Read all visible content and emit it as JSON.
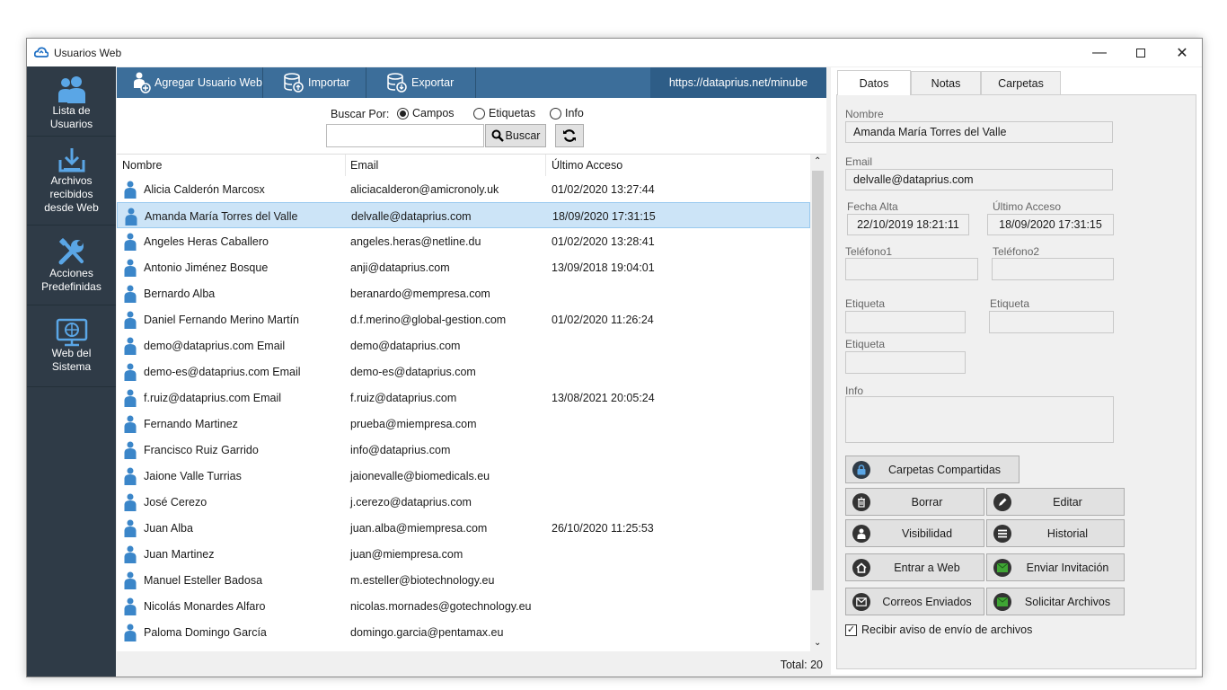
{
  "window": {
    "title": "Usuarios Web"
  },
  "sidebar": {
    "items": [
      {
        "label": "Lista de Usuarios",
        "lines": [
          "Lista de",
          "Usuarios"
        ],
        "icon": "users-icon"
      },
      {
        "label": "Archivos recibidos desde Web",
        "lines": [
          "Archivos",
          "recibidos",
          "desde Web"
        ],
        "icon": "download-icon"
      },
      {
        "label": "Acciones Predefinidas",
        "lines": [
          "Acciones",
          "Predefinidas"
        ],
        "icon": "tools-icon"
      },
      {
        "label": "Web del Sistema",
        "lines": [
          "Web del",
          "Sistema"
        ],
        "icon": "monitor-globe-icon"
      }
    ]
  },
  "toolbar": {
    "add_label": "Agregar Usuario Web",
    "import_label": "Importar",
    "export_label": "Exportar",
    "url": "https://dataprius.net/minube"
  },
  "search": {
    "by_label": "Buscar Por:",
    "options": [
      "Campos",
      "Etiquetas",
      "Info"
    ],
    "selected": "Campos",
    "value": "",
    "button_label": "Buscar"
  },
  "table": {
    "columns": [
      "Nombre",
      "Email",
      "Último Acceso"
    ],
    "selected_index": 1,
    "rows": [
      {
        "name": "Alicia Calderón Marcosx",
        "email": "aliciacalderon@amicronoly.uk",
        "access": "01/02/2020 13:27:44"
      },
      {
        "name": "Amanda María Torres del Valle",
        "email": "delvalle@dataprius.com",
        "access": "18/09/2020 17:31:15"
      },
      {
        "name": "Angeles Heras Caballero",
        "email": "angeles.heras@netline.du",
        "access": "01/02/2020 13:28:41"
      },
      {
        "name": "Antonio Jiménez Bosque",
        "email": "anji@dataprius.com",
        "access": "13/09/2018 19:04:01"
      },
      {
        "name": "Bernardo Alba",
        "email": "beranardo@mempresa.com",
        "access": ""
      },
      {
        "name": "Daniel Fernando Merino Martín",
        "email": "d.f.merino@global-gestion.com",
        "access": "01/02/2020 11:26:24"
      },
      {
        "name": "demo@dataprius.com Email",
        "email": "demo@dataprius.com",
        "access": ""
      },
      {
        "name": "demo-es@dataprius.com Email",
        "email": "demo-es@dataprius.com",
        "access": ""
      },
      {
        "name": "f.ruiz@dataprius.com Email",
        "email": "f.ruiz@dataprius.com",
        "access": "13/08/2021 20:05:24"
      },
      {
        "name": "Fernando Martinez",
        "email": "prueba@miempresa.com",
        "access": ""
      },
      {
        "name": "Francisco Ruiz Garrido",
        "email": "info@dataprius.com",
        "access": ""
      },
      {
        "name": "Jaione Valle Turrias",
        "email": "jaionevalle@biomedicals.eu",
        "access": ""
      },
      {
        "name": "José Cerezo",
        "email": "j.cerezo@dataprius.com",
        "access": ""
      },
      {
        "name": "Juan Alba",
        "email": "juan.alba@miempresa.com",
        "access": "26/10/2020 11:25:53"
      },
      {
        "name": "Juan Martinez",
        "email": "juan@miempresa.com",
        "access": ""
      },
      {
        "name": "Manuel Esteller Badosa",
        "email": "m.esteller@biotechnology.eu",
        "access": ""
      },
      {
        "name": "Nicolás Monardes Alfaro",
        "email": "nicolas.mornades@gotechnology.eu",
        "access": ""
      },
      {
        "name": "Paloma Domingo García",
        "email": "domingo.garcia@pentamax.eu",
        "access": ""
      }
    ],
    "total_label": "Total: 20"
  },
  "details": {
    "tabs": [
      "Datos",
      "Notas",
      "Carpetas"
    ],
    "active_tab": "Datos",
    "nombre_label": "Nombre",
    "nombre": "Amanda María Torres del Valle",
    "email_label": "Email",
    "email": "delvalle@dataprius.com",
    "fecha_alta_label": "Fecha Alta",
    "fecha_alta": "22/10/2019 18:21:11",
    "ultimo_acceso_label": "Último Acceso",
    "ultimo_acceso": "18/09/2020 17:31:15",
    "telefono1_label": "Teléfono1",
    "telefono1": "",
    "telefono2_label": "Teléfono2",
    "telefono2": "",
    "etiqueta_label": "Etiqueta",
    "etiqueta1": "",
    "etiqueta2": "",
    "etiqueta3": "",
    "info_label": "Info",
    "info": "",
    "buttons": {
      "carpetas": "Carpetas Compartidas",
      "borrar": "Borrar",
      "editar": "Editar",
      "visibilidad": "Visibilidad",
      "historial": "Historial",
      "entrar_web": "Entrar a Web",
      "enviar_invitacion": "Enviar Invitación",
      "correos_enviados": "Correos Enviados",
      "solicitar_archivos": "Solicitar Archivos"
    },
    "checkbox_label": "Recibir aviso de envío de archivos",
    "checkbox_checked": true
  },
  "colors": {
    "sidebar": "#2f3b47",
    "toolbar": "#3c6e9a",
    "selected_row": "#cce4f7",
    "user_icon": "#3b86c9",
    "green_icon": "#3fa534"
  }
}
